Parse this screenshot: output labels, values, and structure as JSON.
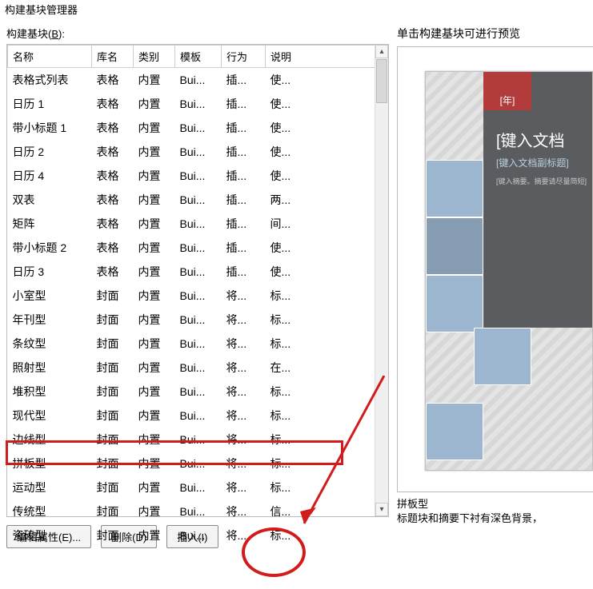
{
  "window": {
    "title": "构建基块管理器"
  },
  "left": {
    "label": "构建基块",
    "label_key": "B",
    "headers": {
      "name": "名称",
      "lib": "库名",
      "cat": "类别",
      "tpl": "模板",
      "act": "行为",
      "desc": "说明"
    },
    "rows": [
      {
        "name": "表格式列表",
        "lib": "表格",
        "cat": "内置",
        "tpl": "Bui...",
        "act": "插...",
        "desc": "使..."
      },
      {
        "name": "日历 1",
        "lib": "表格",
        "cat": "内置",
        "tpl": "Bui...",
        "act": "插...",
        "desc": "使..."
      },
      {
        "name": "带小标题 1",
        "lib": "表格",
        "cat": "内置",
        "tpl": "Bui...",
        "act": "插...",
        "desc": "使..."
      },
      {
        "name": "日历 2",
        "lib": "表格",
        "cat": "内置",
        "tpl": "Bui...",
        "act": "插...",
        "desc": "使..."
      },
      {
        "name": "日历 4",
        "lib": "表格",
        "cat": "内置",
        "tpl": "Bui...",
        "act": "插...",
        "desc": "使..."
      },
      {
        "name": "双表",
        "lib": "表格",
        "cat": "内置",
        "tpl": "Bui...",
        "act": "插...",
        "desc": "两..."
      },
      {
        "name": "矩阵",
        "lib": "表格",
        "cat": "内置",
        "tpl": "Bui...",
        "act": "插...",
        "desc": "间..."
      },
      {
        "name": "带小标题 2",
        "lib": "表格",
        "cat": "内置",
        "tpl": "Bui...",
        "act": "插...",
        "desc": "使..."
      },
      {
        "name": "日历 3",
        "lib": "表格",
        "cat": "内置",
        "tpl": "Bui...",
        "act": "插...",
        "desc": "使..."
      },
      {
        "name": "小室型",
        "lib": "封面",
        "cat": "内置",
        "tpl": "Bui...",
        "act": "将...",
        "desc": "标..."
      },
      {
        "name": "年刊型",
        "lib": "封面",
        "cat": "内置",
        "tpl": "Bui...",
        "act": "将...",
        "desc": "标..."
      },
      {
        "name": "条纹型",
        "lib": "封面",
        "cat": "内置",
        "tpl": "Bui...",
        "act": "将...",
        "desc": "标..."
      },
      {
        "name": "照射型",
        "lib": "封面",
        "cat": "内置",
        "tpl": "Bui...",
        "act": "将...",
        "desc": "在..."
      },
      {
        "name": "堆积型",
        "lib": "封面",
        "cat": "内置",
        "tpl": "Bui...",
        "act": "将...",
        "desc": "标..."
      },
      {
        "name": "现代型",
        "lib": "封面",
        "cat": "内置",
        "tpl": "Bui...",
        "act": "将...",
        "desc": "标..."
      },
      {
        "name": "边线型",
        "lib": "封面",
        "cat": "内置",
        "tpl": "Bui...",
        "act": "将...",
        "desc": "标..."
      },
      {
        "name": "拼板型",
        "lib": "封面",
        "cat": "内置",
        "tpl": "Bui...",
        "act": "将...",
        "desc": "标..."
      },
      {
        "name": "运动型",
        "lib": "封面",
        "cat": "内置",
        "tpl": "Bui...",
        "act": "将...",
        "desc": "标..."
      },
      {
        "name": "传统型",
        "lib": "封面",
        "cat": "内置",
        "tpl": "Bui...",
        "act": "将...",
        "desc": "信..."
      },
      {
        "name": "瓷砖型",
        "lib": "封面",
        "cat": "内置",
        "tpl": "Bui...",
        "act": "将...",
        "desc": "标..."
      }
    ],
    "buttons": {
      "edit": "编辑属性(E)...",
      "delete": "删除(D)",
      "insert": "插入(I)"
    }
  },
  "right": {
    "preview_label": "单击构建基块可进行预览",
    "cover": {
      "year": "[年]",
      "title": "[键入文档",
      "subtitle": "[键入文档副标题]",
      "note": "[键入摘要。摘要请尽量简短]"
    },
    "caption": {
      "name": "拼板型",
      "desc": "标题块和摘要下衬有深色背景，"
    }
  },
  "annotations": {
    "highlighted_row_index": 16,
    "circled_button": "insert"
  }
}
